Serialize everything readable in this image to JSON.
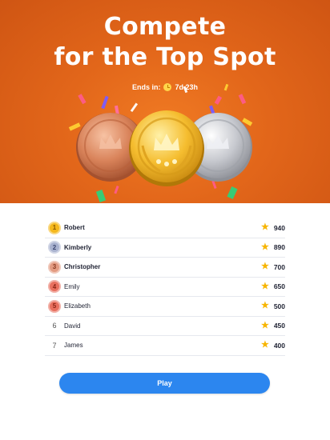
{
  "header": {
    "title_line1": "Compete",
    "title_line2": "for the Top Spot",
    "ends_label": "Ends in:",
    "ends_value": "7d 23h"
  },
  "leaderboard": [
    {
      "rank": "1",
      "name": "Robert",
      "score": "940",
      "badge": "gold"
    },
    {
      "rank": "2",
      "name": "Kimberly",
      "score": "890",
      "badge": "silver"
    },
    {
      "rank": "3",
      "name": "Christopher",
      "score": "700",
      "badge": "bronze"
    },
    {
      "rank": "4",
      "name": "Emily",
      "score": "650",
      "badge": "red"
    },
    {
      "rank": "5",
      "name": "Elizabeth",
      "score": "500",
      "badge": "red"
    },
    {
      "rank": "6",
      "name": "David",
      "score": "450",
      "badge": "none"
    },
    {
      "rank": "7",
      "name": "James",
      "score": "400",
      "badge": "none"
    }
  ],
  "play_label": "Play",
  "colors": {
    "hero_orange": "#e2661a",
    "accent_blue": "#2c86ef",
    "gold": "#f5b81c",
    "silver": "#a9b2cf",
    "bronze": "#e39b82",
    "red": "#e8705f",
    "star": "#f7b500"
  },
  "icons": {
    "clock": "clock-icon",
    "star": "star-icon",
    "medal": "crown-medal-icon"
  }
}
